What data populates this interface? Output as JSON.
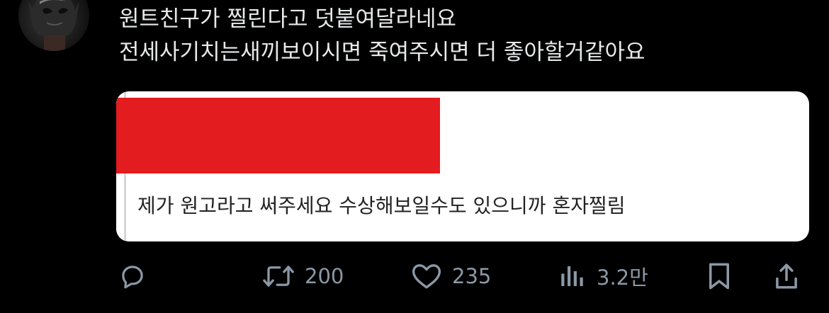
{
  "tweet": {
    "text_line1": "원트친구가 찔린다고 덧붙여달라네요",
    "text_line2": "전세사기치는새끼보이시면 죽여주시면 더 좋아할거같아요"
  },
  "quote": {
    "text": "제가 원고라고 써주세요 수상해보일수도 있으니까 혼자찔림",
    "redaction_color": "#e31c1f"
  },
  "actions": {
    "reply": {
      "icon": "reply-icon"
    },
    "retweet": {
      "icon": "retweet-icon",
      "count": "200"
    },
    "like": {
      "icon": "heart-icon",
      "count": "235"
    },
    "views": {
      "icon": "views-icon",
      "count": "3.2만"
    },
    "bookmark": {
      "icon": "bookmark-icon"
    },
    "share": {
      "icon": "share-icon"
    }
  },
  "colors": {
    "background": "#000000",
    "text": "#e7e9ea",
    "muted": "#8b98a5",
    "card": "#ffffff"
  }
}
